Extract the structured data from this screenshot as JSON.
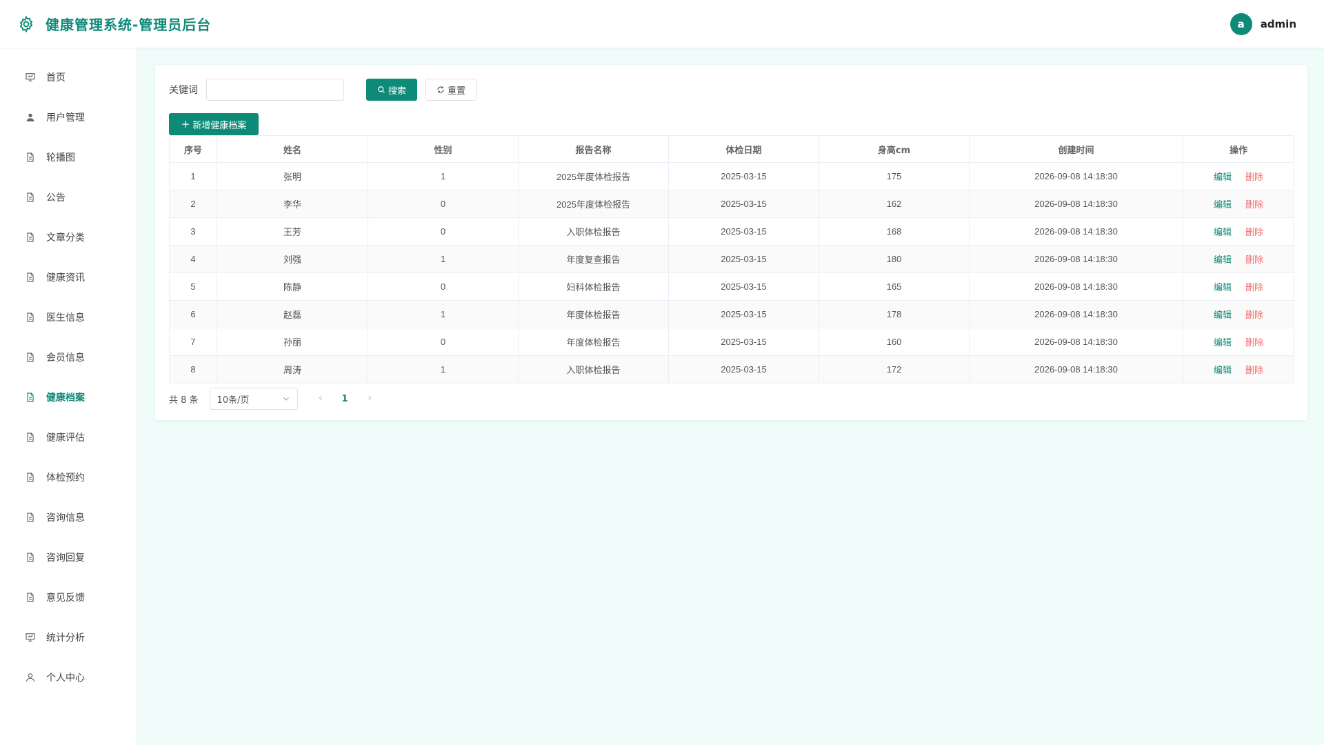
{
  "app": {
    "title": "健康管理系统-管理员后台",
    "accent": "#0e8a78",
    "danger": "#f56c6c",
    "brand_icon": "gear-icon"
  },
  "user": {
    "avatar_letter": "a",
    "name": "admin"
  },
  "sidebar": {
    "items": [
      {
        "label": "首页",
        "icon": "presentation-icon",
        "active": false
      },
      {
        "label": "用户管理",
        "icon": "user-icon",
        "active": false
      },
      {
        "label": "轮播图",
        "icon": "document-icon",
        "active": false
      },
      {
        "label": "公告",
        "icon": "document-icon",
        "active": false
      },
      {
        "label": "文章分类",
        "icon": "document-icon",
        "active": false
      },
      {
        "label": "健康资讯",
        "icon": "document-icon",
        "active": false
      },
      {
        "label": "医生信息",
        "icon": "document-icon",
        "active": false
      },
      {
        "label": "会员信息",
        "icon": "document-icon",
        "active": false
      },
      {
        "label": "健康档案",
        "icon": "document-icon",
        "active": true
      },
      {
        "label": "健康评估",
        "icon": "document-icon",
        "active": false
      },
      {
        "label": "体检预约",
        "icon": "document-icon",
        "active": false
      },
      {
        "label": "咨询信息",
        "icon": "document-icon",
        "active": false
      },
      {
        "label": "咨询回复",
        "icon": "document-icon",
        "active": false
      },
      {
        "label": "意见反馈",
        "icon": "document-icon",
        "active": false
      },
      {
        "label": "统计分析",
        "icon": "presentation-icon",
        "active": false
      },
      {
        "label": "个人中心",
        "icon": "user-outline-icon",
        "active": false
      }
    ]
  },
  "search": {
    "label": "关键词",
    "value": "",
    "placeholder": "",
    "search_btn": "搜索",
    "reset_btn": "重置"
  },
  "toolbar": {
    "add_btn": "新增健康档案"
  },
  "table": {
    "headers": [
      "序号",
      "姓名",
      "性别",
      "报告名称",
      "体检日期",
      "身高cm",
      "创建时间",
      "操作"
    ],
    "edit_label": "编辑",
    "delete_label": "删除",
    "rows": [
      [
        "1",
        "张明",
        "1",
        "2025年度体检报告",
        "2025-03-15",
        "175",
        "2026-09-08 14:18:30"
      ],
      [
        "2",
        "李华",
        "0",
        "2025年度体检报告",
        "2025-03-15",
        "162",
        "2026-09-08 14:18:30"
      ],
      [
        "3",
        "王芳",
        "0",
        "入职体检报告",
        "2025-03-15",
        "168",
        "2026-09-08 14:18:30"
      ],
      [
        "4",
        "刘强",
        "1",
        "年度复查报告",
        "2025-03-15",
        "180",
        "2026-09-08 14:18:30"
      ],
      [
        "5",
        "陈静",
        "0",
        "妇科体检报告",
        "2025-03-15",
        "165",
        "2026-09-08 14:18:30"
      ],
      [
        "6",
        "赵磊",
        "1",
        "年度体检报告",
        "2025-03-15",
        "178",
        "2026-09-08 14:18:30"
      ],
      [
        "7",
        "孙丽",
        "0",
        "年度体检报告",
        "2025-03-15",
        "160",
        "2026-09-08 14:18:30"
      ],
      [
        "8",
        "周涛",
        "1",
        "入职体检报告",
        "2025-03-15",
        "172",
        "2026-09-08 14:18:30"
      ]
    ]
  },
  "pager": {
    "total": "共 8 条",
    "page_size": "10条/页",
    "current_page": "1"
  }
}
